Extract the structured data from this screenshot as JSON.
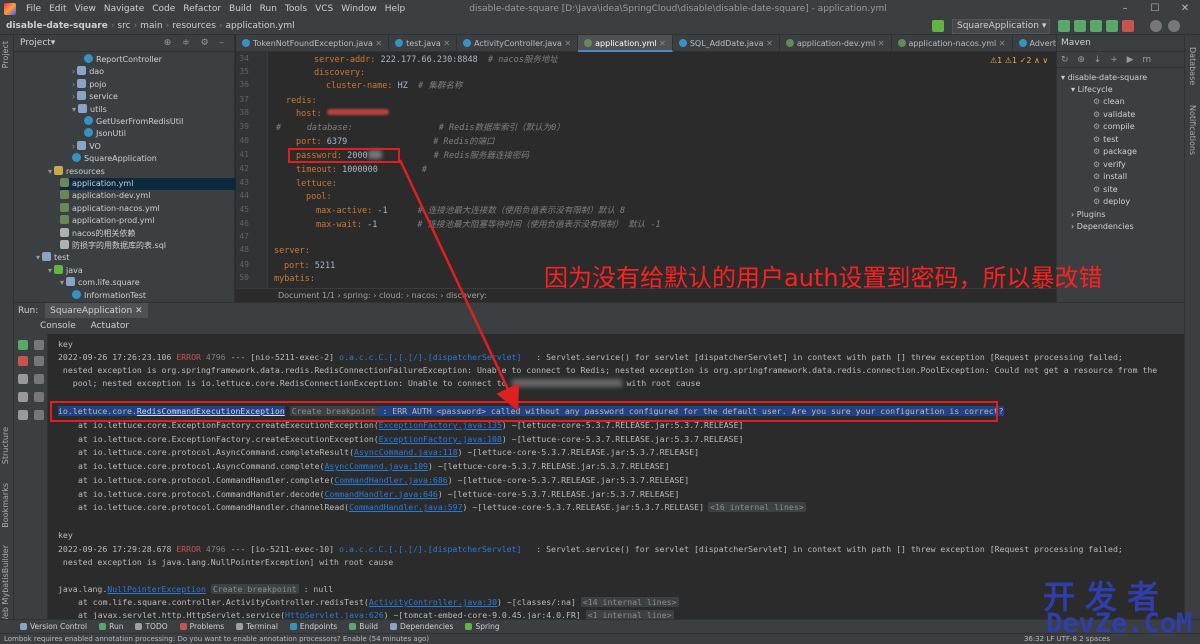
{
  "menu": {
    "items": [
      "File",
      "Edit",
      "View",
      "Navigate",
      "Code",
      "Refactor",
      "Build",
      "Run",
      "Tools",
      "VCS",
      "Window",
      "Help"
    ],
    "title": "disable-date-square [D:\\Java\\idea\\SpringCloud\\disable\\disable-date-square] - application.yml"
  },
  "navbar": {
    "crumbs": [
      "disable-date-square",
      "src",
      "main",
      "resources",
      "application.yml"
    ],
    "run_config": "SquareApplication"
  },
  "project": {
    "title": "Project",
    "tree": [
      {
        "label": "ReportController",
        "icon": "class-icon",
        "depth": 4
      },
      {
        "label": "dao",
        "icon": "folder-icon",
        "depth": 3
      },
      {
        "label": "pojo",
        "icon": "folder-icon",
        "depth": 3
      },
      {
        "label": "service",
        "icon": "folder-icon",
        "depth": 3
      },
      {
        "label": "utils",
        "icon": "folder-icon",
        "depth": 3
      },
      {
        "label": "GetUserFromRedisUtil",
        "icon": "class-icon",
        "depth": 4
      },
      {
        "label": "JsonUtil",
        "icon": "class-icon",
        "depth": 4
      },
      {
        "label": "VO",
        "icon": "folder-icon",
        "depth": 3
      },
      {
        "label": "SquareApplication",
        "icon": "class-icon",
        "depth": 3
      },
      {
        "label": "resources",
        "icon": "resources-icon",
        "depth": 1
      },
      {
        "label": "application.yml",
        "icon": "yml-icon",
        "depth": 2
      },
      {
        "label": "application-dev.yml",
        "icon": "yml-icon",
        "depth": 2
      },
      {
        "label": "application-nacos.yml",
        "icon": "yml-icon",
        "depth": 2
      },
      {
        "label": "application-prod.yml",
        "icon": "yml-icon",
        "depth": 2
      },
      {
        "label": "nacos的相关依赖",
        "icon": "file-icon",
        "depth": 2
      },
      {
        "label": "防损字的用数据库的表.sql",
        "icon": "sql-icon",
        "depth": 2
      },
      {
        "label": "test",
        "icon": "folder-icon",
        "depth": 0
      },
      {
        "label": "java",
        "icon": "test-folder-icon",
        "depth": 1
      },
      {
        "label": "com.life.square",
        "icon": "folder-icon",
        "depth": 2
      },
      {
        "label": "InformationTest",
        "icon": "class-icon",
        "depth": 3
      }
    ]
  },
  "tabs": [
    {
      "label": "TokenNotFoundException.java",
      "color": "#3592c4"
    },
    {
      "label": "test.java",
      "color": "#3592c4"
    },
    {
      "label": "ActivityController.java",
      "color": "#3592c4"
    },
    {
      "label": "application.yml",
      "color": "#6a8759",
      "active": true
    },
    {
      "label": "SQL_AddDate.java",
      "color": "#3592c4"
    },
    {
      "label": "application-dev.yml",
      "color": "#6a8759"
    },
    {
      "label": "application-nacos.yml",
      "color": "#6a8759"
    },
    {
      "label": "AdvertisingContro",
      "color": "#3592c4"
    }
  ],
  "editor": {
    "line_numbers": [
      "34",
      "35",
      "36",
      "37",
      "38",
      "39",
      "40",
      "41",
      "42",
      "43",
      "44",
      "45",
      "46",
      "47",
      "48",
      "49",
      "50"
    ],
    "lines": {
      "l34": {
        "key": "server-addr:",
        "value": " 222.177.66.230:8848",
        "comment": "  # nacos服务地址"
      },
      "l35": {
        "key": "discovery:"
      },
      "l36": {
        "key": "cluster-name:",
        "value": " HZ",
        "comment": "  # 集群名称"
      },
      "l38": {
        "key": "redis:"
      },
      "l39": {
        "key": "host:"
      },
      "l40": {
        "hash": "#",
        "key": "database:",
        "comment": "# Redis数据库索引（默认为0）"
      },
      "l41": {
        "key": "port:",
        "value": " 6379",
        "comment": "# Redis的端口"
      },
      "l42": {
        "key": "password:",
        "value": " 2000",
        "comment": "# Redis服务器连接密码"
      },
      "l43": {
        "key": "timeout:",
        "value": " 1000000",
        "comment": "#"
      },
      "l44": {
        "key": "lettuce:"
      },
      "l45": {
        "key": "pool:"
      },
      "l46": {
        "key": "max-active:",
        "value": " -1",
        "comment": "# 连接池最大连接数（使用负值表示没有限制）默认 8"
      },
      "l47": {
        "key": "max-wait:",
        "value": " -1",
        "comment": "# 连接池最大阻塞等待时间（使用负值表示没有限制） 默认 -1"
      },
      "l49": {
        "key": "server:"
      },
      "l50": {
        "key": "port:",
        "value": " 5211"
      },
      "l51": {
        "key": "mybatis:"
      }
    },
    "inspections": "⚠1 ⚠1 ✓2 ∧ ∨",
    "breadcrumb": "Document 1/1   ›   spring:   ›   cloud:   ›   nacos:   ›   discovery:"
  },
  "annotation": {
    "text": "因为没有给默认的用户auth设置到密码，所以暴改错"
  },
  "maven": {
    "title": "Maven",
    "toolbar": "↻ ⊕ ↓ + ▶ m",
    "root": "disable-date-square",
    "lifecycle": "Lifecycle",
    "goals": [
      "clean",
      "validate",
      "compile",
      "test",
      "package",
      "verify",
      "install",
      "site",
      "deploy"
    ],
    "plugins": "Plugins",
    "dependencies": "Dependencies"
  },
  "run": {
    "label": "Run:",
    "config": "SquareApplication",
    "tabs": [
      "Console",
      "Actuator"
    ]
  },
  "console": {
    "key1": "key",
    "e1": {
      "time": "2022-09-26 17:26:23.106",
      "level": "ERROR",
      "pid": "4796",
      "sep": "---",
      "thread": "[nio-5211-exec-2]",
      "logger": "o.a.c.c.C.[.[.[/].[dispatcherServlet]",
      "msg": "   : Servlet.service() for servlet [dispatcherServlet] in context with path [] threw exception [Request processing failed;"
    },
    "e1b": " nested exception is org.springframework.data.redis.RedisConnectionFailureException: Unable to connect to Redis; nested exception is org.springframework.data.redis.connection.PoolException: Could not get a resource from the",
    "e1c": "   pool; nested exception is io.lettuce.core.RedisConnectionException: Unable to connect to",
    "e1c_tail": " with root cause",
    "ex_pkg": "io.lettuce.core.",
    "ex_class": "RedisCommandExecutionException",
    "create_bp": "Create breakpoint",
    "ex_msg": " : ERR AUTH <password> called without any password configured for the default user. Are you sure your configuration is correct?",
    "stack": [
      {
        "pre": "at io.lettuce.core.ExceptionFactory.createExecutionException(",
        "link": "ExceptionFactory.java:135",
        "post": ") ~[lettuce-core-5.3.7.RELEASE.jar:5.3.7.RELEASE]"
      },
      {
        "pre": "at io.lettuce.core.ExceptionFactory.createExecutionException(",
        "link": "ExceptionFactory.java:108",
        "post": ") ~[lettuce-core-5.3.7.RELEASE.jar:5.3.7.RELEASE]"
      },
      {
        "pre": "at io.lettuce.core.protocol.AsyncCommand.completeResult(",
        "link": "AsyncCommand.java:118",
        "post": ") ~[lettuce-core-5.3.7.RELEASE.jar:5.3.7.RELEASE]"
      },
      {
        "pre": "at io.lettuce.core.protocol.AsyncCommand.complete(",
        "link": "AsyncCommand.java:109",
        "post": ") ~[lettuce-core-5.3.7.RELEASE.jar:5.3.7.RELEASE]"
      },
      {
        "pre": "at io.lettuce.core.protocol.CommandHandler.complete(",
        "link": "CommandHandler.java:686",
        "post": ") ~[lettuce-core-5.3.7.RELEASE.jar:5.3.7.RELEASE]"
      },
      {
        "pre": "at io.lettuce.core.protocol.CommandHandler.decode(",
        "link": "CommandHandler.java:646",
        "post": ") ~[lettuce-core-5.3.7.RELEASE.jar:5.3.7.RELEASE]"
      },
      {
        "pre": "at io.lettuce.core.protocol.CommandHandler.channelRead(",
        "link": "CommandHandler.java:597",
        "post": ") ~[lettuce-core-5.3.7.RELEASE.jar:5.3.7.RELEASE]",
        "chip": "<16 internal lines>"
      }
    ],
    "key2": "key",
    "e2": {
      "time": "2022-09-26 17:29:28.678",
      "level": "ERROR",
      "pid": "4796",
      "sep": "---",
      "thread": "[io-5211-exec-10]",
      "logger": "o.a.c.c.C.[.[.[/].[dispatcherServlet]",
      "msg": "   : Servlet.service() for servlet [dispatcherServlet] in context with path [] threw exception [Request processing failed;"
    },
    "e2b": " nested exception is java.lang.NullPointerException] with root cause",
    "npe_pkg": "java.lang.",
    "npe_class": "NullPointerException",
    "npe_tail": " : null",
    "s2_1": {
      "pre": "at com.life.square.controller.ActivityController.redisTest(",
      "link": "ActivityController.java:30",
      "post": ") ~[classes/:na]",
      "chip": "<14 internal lines>"
    },
    "s2_2": {
      "pre": "at javax.servlet.http.HttpServlet.service(",
      "link": "HttpServlet.java:626",
      "post": ") ~[tomcat-embed-core-9.0.45.jar:4.0.FR]",
      "chip": "<1 internal line>"
    }
  },
  "bottom_tabs": [
    "Version Control",
    "Run",
    "TODO",
    "Problems",
    "Terminal",
    "Endpoints",
    "Build",
    "Dependencies",
    "Spring"
  ],
  "status": {
    "message": "Lombok requires enabled annotation processing: Do you want to enable annotation processors? Enable (54 minutes ago)",
    "right": "36:32   LF   UTF-8   2 spaces"
  },
  "left_strip": [
    "Project",
    "Structure",
    "Bookmarks",
    "MybatisBuilder",
    "Web"
  ],
  "right_strip": [
    "Database",
    "Notifications"
  ],
  "watermark": {
    "line1": "开发者",
    "line2": "DevZe.CoM"
  }
}
